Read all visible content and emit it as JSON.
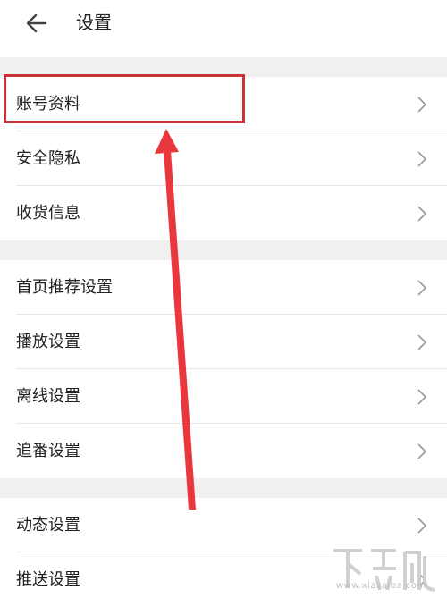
{
  "header": {
    "title": "设置",
    "back_icon": "arrow-left-icon"
  },
  "groups": [
    {
      "items": [
        {
          "label": "账号资料"
        },
        {
          "label": "安全隐私"
        },
        {
          "label": "收货信息"
        }
      ]
    },
    {
      "items": [
        {
          "label": "首页推荐设置"
        },
        {
          "label": "播放设置"
        },
        {
          "label": "离线设置"
        },
        {
          "label": "追番设置"
        }
      ]
    },
    {
      "items": [
        {
          "label": "动态设置"
        },
        {
          "label": "推送设置"
        }
      ]
    }
  ],
  "annotation": {
    "highlight_color": "#c8323a",
    "arrow_color": "#e8383d"
  },
  "watermark": {
    "text": "www.xiazaiba.com",
    "logo": "下载吧"
  }
}
